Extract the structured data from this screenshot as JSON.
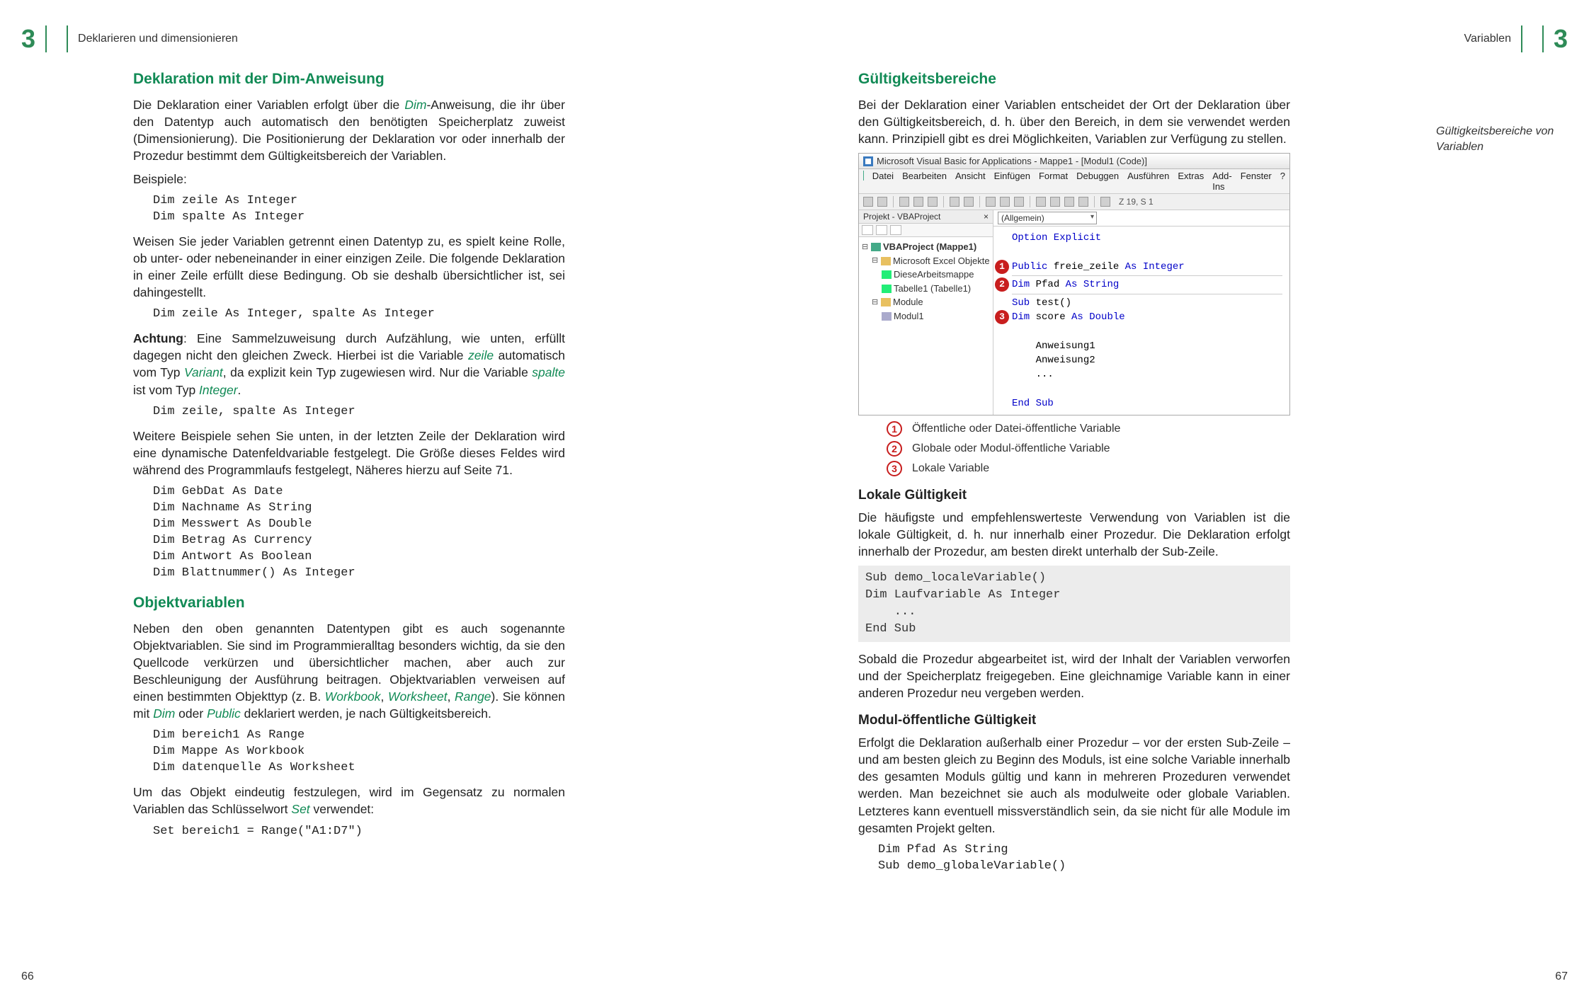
{
  "left": {
    "chapnum": "3",
    "crumb": "Deklarieren und dimensionieren",
    "h2a": "Deklaration mit der Dim-Anweisung",
    "p1a": "Die Deklaration einer Variablen erfolgt über die ",
    "p1b": "-Anweisung, die ihr über den Datentyp auch automatisch den benötigten Speicherplatz zuweist (Dimensionierung). Die Positionierung der Deklaration vor oder innerhalb der Prozedur bestimmt dem Gültigkeitsbereich der Variablen.",
    "kw_dim": "Dim",
    "beispiele_label": "Beispiele:",
    "code1": "Dim zeile As Integer\nDim spalte As Integer",
    "p2": "Weisen Sie jeder Variablen getrennt einen Datentyp zu, es spielt keine Rolle, ob unter- oder nebeneinander in einer einzigen Zeile. Die folgende Deklaration in einer Zeile erfüllt diese Bedingung. Ob sie deshalb übersichtlicher ist, sei dahingestellt.",
    "code2": "Dim zeile As Integer, spalte As Integer",
    "p3_strong": "Achtung",
    "p3a": ": Eine Sammelzuweisung durch Aufzählung, wie unten, erfüllt dagegen nicht den gleichen Zweck. Hierbei ist die Variable ",
    "kw_zeile": "zeile",
    "p3b": " automatisch vom Typ ",
    "kw_variant": "Variant",
    "p3c": ", da explizit kein Typ zugewiesen wird. Nur die Variable ",
    "kw_spalte": "spalte",
    "p3d": " ist vom Typ ",
    "kw_integer": "Integer",
    "p3e": ".",
    "code3": "Dim zeile, spalte As Integer",
    "p4": "Weitere Beispiele sehen Sie unten, in der letzten Zeile der Deklaration wird eine dynamische Datenfeldvariable festgelegt. Die Größe dieses Feldes wird während des Programmlaufs festgelegt, Näheres hierzu auf Seite 71.",
    "code4": "Dim GebDat As Date\nDim Nachname As String\nDim Messwert As Double\nDim Betrag As Currency\nDim Antwort As Boolean\nDim Blattnummer() As Integer",
    "h2b": "Objektvariablen",
    "p5a": "Neben den oben genannten Datentypen gibt es auch sogenannte Objektvariablen. Sie sind im Programmieralltag besonders wichtig, da sie den Quellcode verkürzen und übersichtlicher machen, aber auch zur Beschleunigung der Ausführung beitragen. Objektvariablen verweisen auf einen bestimmten Objekttyp (z. B. ",
    "kw_workbook": "Workbook",
    "kw_worksheet": "Worksheet",
    "kw_range": "Range",
    "p5b": "). Sie können mit ",
    "p5c": " oder ",
    "kw_public": "Public",
    "p5d": " deklariert werden, je nach Gültigkeitsbereich.",
    "code5": "Dim bereich1 As Range\nDim Mappe As Workbook\nDim datenquelle As Worksheet",
    "p6a": "Um das Objekt eindeutig festzulegen, wird im Gegensatz zu normalen Variablen das Schlüsselwort ",
    "kw_set": "Set",
    "p6b": " verwendet:",
    "code6": "Set bereich1 = Range(\"A1:D7\")",
    "pagenum": "66"
  },
  "right": {
    "chapnum": "3",
    "crumb": "Variablen",
    "h2a": "Gültigkeitsbereiche",
    "p1": "Bei der Deklaration einer Variablen entscheidet der Ort der Deklaration über den Gültigkeitsbereich, d. h. über den Bereich, in dem sie verwendet werden kann. Prinzipiell gibt es drei Möglichkeiten, Variablen zur Verfügung zu stellen.",
    "margin_note": "Gültigkeitsbereiche von Variablen",
    "ide": {
      "title": "Microsoft Visual Basic for Applications - Mappe1 - [Modul1 (Code)]",
      "menu": [
        "Datei",
        "Bearbeiten",
        "Ansicht",
        "Einfügen",
        "Format",
        "Debuggen",
        "Ausführen",
        "Extras",
        "Add-Ins",
        "Fenster",
        "?"
      ],
      "cursor": "Z 19, S 1",
      "proj_title": "Projekt - VBAProject",
      "combo": "(Allgemein)",
      "tree": {
        "root": "VBAProject (Mappe1)",
        "f1": "Microsoft Excel Objekte",
        "f1a": "DieseArbeitsmappe",
        "f1b": "Tabelle1 (Tabelle1)",
        "f2": "Module",
        "f2a": "Modul1"
      },
      "code": {
        "l1": "Option Explicit",
        "l2a": "Public",
        "l2b": " freie_zeile ",
        "l2c": "As Integer",
        "l3a": "Dim",
        "l3b": " Pfad ",
        "l3c": "As String",
        "l4a": "Sub",
        "l4b": " test()",
        "l5a": "Dim",
        "l5b": " score ",
        "l5c": "As Double",
        "l6": "Anweisung1",
        "l7": "Anweisung2",
        "l8": "...",
        "l9": "End Sub"
      }
    },
    "legend": {
      "i1": "Öffentliche oder Datei-öffentliche Variable",
      "i2": "Globale oder Modul-öffentliche Variable",
      "i3": "Lokale Variable"
    },
    "h3a": "Lokale Gültigkeit",
    "p2": "Die häufigste und empfehlenswerteste Verwendung von Variablen ist die lokale Gültigkeit, d. h. nur innerhalb einer Prozedur. Die Deklaration erfolgt innerhalb der Prozedur, am besten direkt unterhalb der Sub-Zeile.",
    "codebox1": "Sub demo_localeVariable()\nDim Laufvariable As Integer\n    ...\nEnd Sub",
    "p3": "Sobald die Prozedur abgearbeitet ist, wird der Inhalt der Variablen verworfen und der Speicherplatz freigegeben. Eine gleichnamige Variable kann in einer anderen Prozedur neu vergeben werden.",
    "h3b": "Modul-öffentliche Gültigkeit",
    "p4": "Erfolgt die Deklaration außerhalb einer Prozedur – vor der ersten Sub-Zeile – und am besten gleich zu Beginn des Moduls, ist eine solche Variable innerhalb des gesamten Moduls gültig und kann in mehreren Prozeduren verwendet werden. Man bezeichnet sie auch als modulweite oder globale Variablen. Letzteres kann eventuell missverständlich sein, da sie nicht für alle Module im gesamten Projekt gelten.",
    "code7": "Dim Pfad As String\nSub demo_globaleVariable()",
    "pagenum": "67"
  }
}
